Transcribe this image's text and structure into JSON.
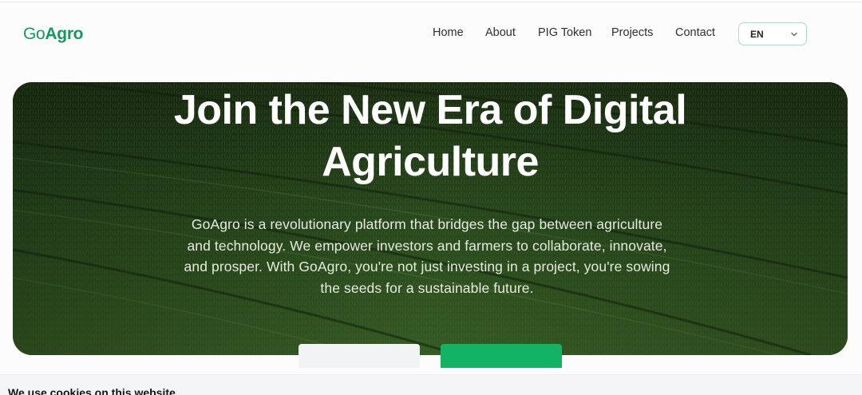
{
  "header": {
    "logo_prefix": "Go",
    "logo_suffix": "Agro",
    "nav": [
      "Home",
      "About",
      "PIG Token",
      "Projects",
      "Contact"
    ],
    "language": "EN"
  },
  "hero": {
    "title_line1": "Join the New Era of Digital",
    "title_line2": "Agriculture",
    "text_lines": [
      "GoAgro is a revolutionary platform that bridges the gap between agriculture",
      "and technology. We empower investors and farmers to collaborate, innovate,",
      "and prosper. With GoAgro, you're not just investing in a project, you're sowing",
      "the seeds for a sustainable future."
    ]
  },
  "cookie_banner": {
    "text": "We use cookies on this website"
  },
  "colors": {
    "brand_green": "#16995a",
    "button_green": "#12b463",
    "hero_dark": "#2a4a1e"
  },
  "icons": {
    "language_dropdown": "chevron-down-icon"
  }
}
